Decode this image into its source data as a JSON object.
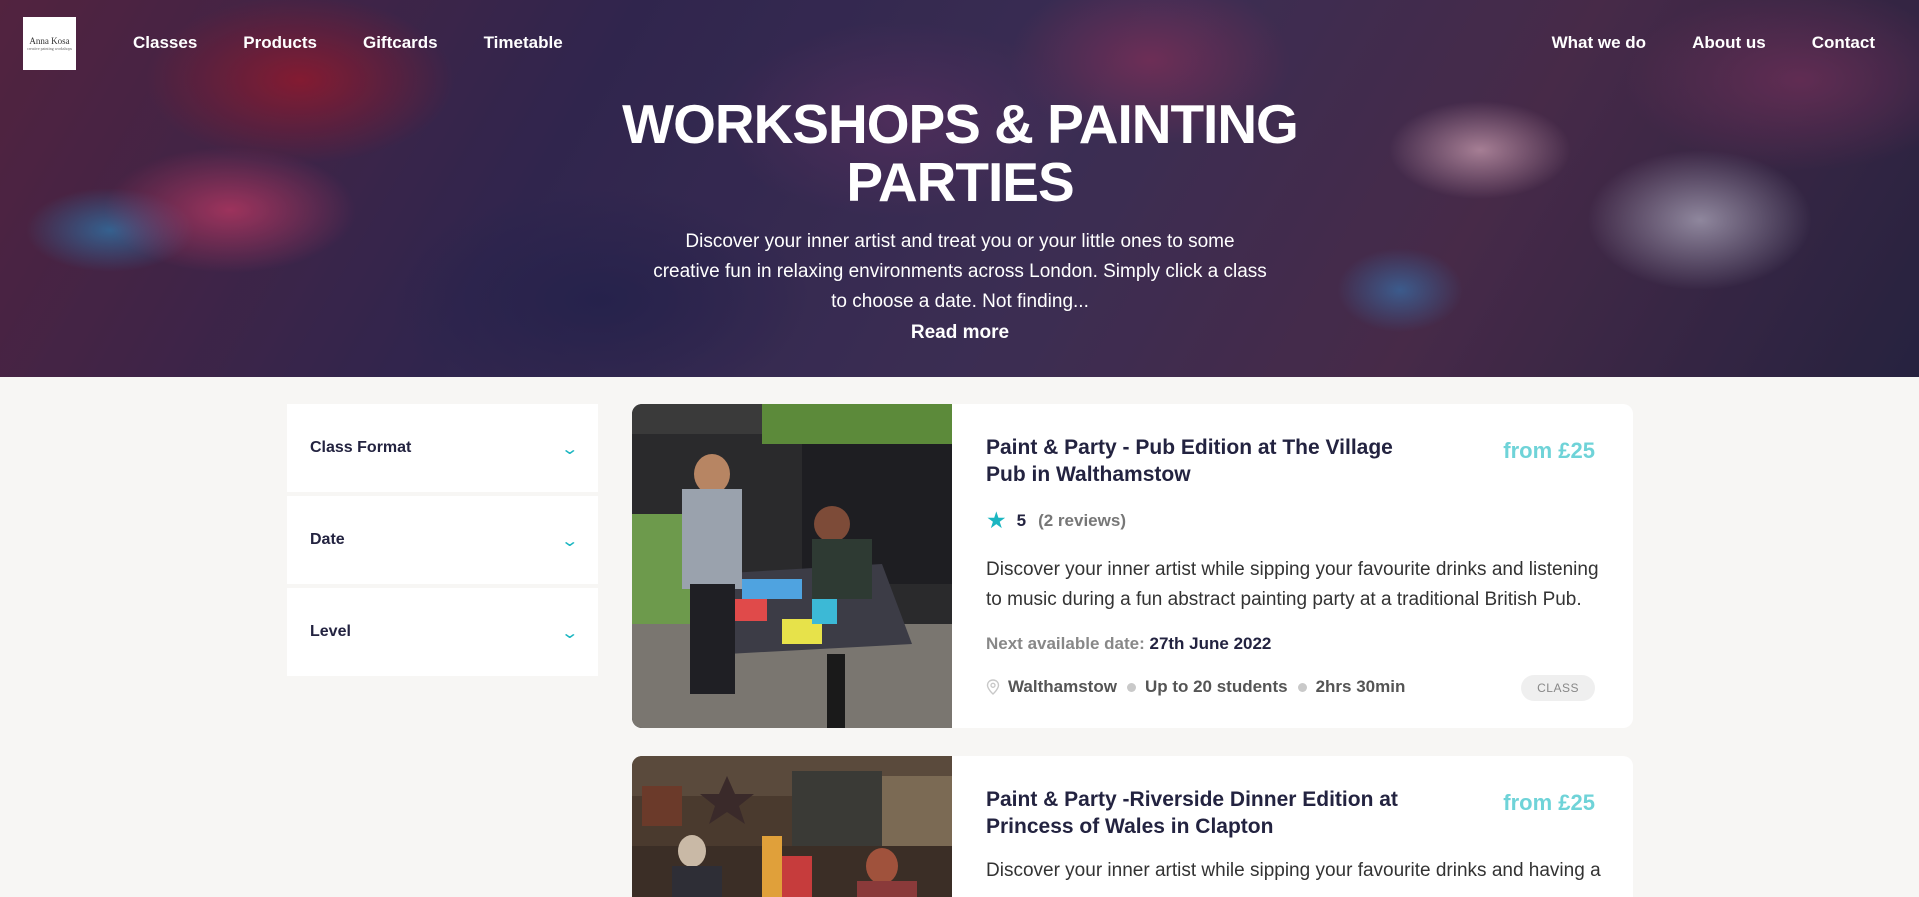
{
  "logo": {
    "line1": "Anna Kosa",
    "line2": "creative painting workshops"
  },
  "nav": {
    "left": [
      "Classes",
      "Products",
      "Giftcards",
      "Timetable"
    ],
    "right": [
      "What we do",
      "About us",
      "Contact"
    ]
  },
  "hero": {
    "title_line1": "WORKSHOPS & PAINTING",
    "title_line2": "PARTIES",
    "description": "Discover your inner artist and treat you or your little ones to some creative fun in relaxing environments across London. Simply click a class to choose a date. Not finding...",
    "read_more": "Read more"
  },
  "filters": [
    {
      "label": "Class Format"
    },
    {
      "label": "Date"
    },
    {
      "label": "Level"
    }
  ],
  "cards": [
    {
      "title": "Paint & Party - Pub Edition at The Village Pub in Walthamstow",
      "price": "from £25",
      "rating": "5",
      "reviews": "(2 reviews)",
      "description": "Discover your inner artist while sipping your favourite drinks and listening to music during a fun abstract painting party at a traditional British Pub.",
      "next_label": "Next available date:",
      "next_date": "27th June 2022",
      "location": "Walthamstow",
      "capacity": "Up to 20 students",
      "duration": "2hrs 30min",
      "tag": "CLASS"
    },
    {
      "title": "Paint & Party -Riverside Dinner Edition at Princess of Wales in Clapton",
      "price": "from £25",
      "description": "Discover your inner artist while sipping your favourite drinks and having a"
    }
  ],
  "colors": {
    "accent": "#1bb6c1",
    "price": "#6fd3d8",
    "text": "#232340",
    "background": "#f7f6f4"
  }
}
